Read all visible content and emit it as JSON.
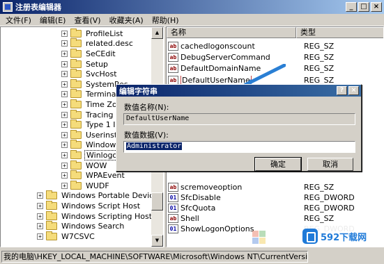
{
  "window": {
    "title": "注册表编辑器"
  },
  "menu": [
    "文件(F)",
    "编辑(E)",
    "查看(V)",
    "收藏夹(A)",
    "帮助(H)"
  ],
  "tree": [
    {
      "label": "ProfileList",
      "depth": 2
    },
    {
      "label": "related.desc",
      "depth": 2
    },
    {
      "label": "SeCEdit",
      "depth": 2
    },
    {
      "label": "Setup",
      "depth": 2
    },
    {
      "label": "SvcHost",
      "depth": 2
    },
    {
      "label": "SystemRes",
      "depth": 2
    },
    {
      "label": "Terminal Se",
      "depth": 2
    },
    {
      "label": "Time Zones",
      "depth": 2
    },
    {
      "label": "Tracing",
      "depth": 2
    },
    {
      "label": "Type 1 Ins",
      "depth": 2
    },
    {
      "label": "Userinstalla",
      "depth": 2
    },
    {
      "label": "Windows",
      "depth": 2
    },
    {
      "label": "Winlogon",
      "depth": 2,
      "selected": true
    },
    {
      "label": "WOW",
      "depth": 2
    },
    {
      "label": "WPAEvent",
      "depth": 2
    },
    {
      "label": "WUDF",
      "depth": 2
    },
    {
      "label": "Windows Portable Devices",
      "depth": 1
    },
    {
      "label": "Windows Script Host",
      "depth": 1
    },
    {
      "label": "Windows Scripting Host",
      "depth": 1
    },
    {
      "label": "Windows Search",
      "depth": 1
    },
    {
      "label": "W7CSVC",
      "depth": 1
    }
  ],
  "list": {
    "headers": {
      "name": "名称",
      "type": "类型"
    },
    "rows": [
      {
        "name": "cachedlogonscount",
        "type": "REG_SZ",
        "icon": "ab"
      },
      {
        "name": "DebugServerCommand",
        "type": "REG_SZ",
        "icon": "ab"
      },
      {
        "name": "DefaultDomainName",
        "type": "REG_SZ",
        "icon": "ab"
      },
      {
        "name": "DefaultUserName",
        "type": "REG_SZ",
        "icon": "ab",
        "highlight": true
      },
      {
        "name": "scremoveoption",
        "type": "REG_SZ",
        "icon": "ab"
      },
      {
        "name": "SfcDisable",
        "type": "REG_DWORD",
        "icon": "bin"
      },
      {
        "name": "SfcQuota",
        "type": "REG_DWORD",
        "icon": "bin"
      },
      {
        "name": "Shell",
        "type": "REG_SZ",
        "icon": "ab"
      },
      {
        "name": "ShowLogonOptions",
        "type": "REG_DWORD",
        "icon": "bin"
      }
    ]
  },
  "statusbar": {
    "text": "我的电脑\\HKEY_LOCAL_MACHINE\\SOFTWARE\\Microsoft\\Windows NT\\CurrentVersion\\Winlogon"
  },
  "dialog": {
    "title": "编辑字符串",
    "help_glyph": "?",
    "close_glyph": "×",
    "name_label": "数值名称(N):",
    "name_value": "DefaultUserName",
    "data_label": "数值数据(V):",
    "data_value": "Administrator",
    "ok_label": "确定",
    "cancel_label": "取消"
  },
  "watermark": {
    "text": "592下载网",
    "url_hint": "5928.COM"
  },
  "colors": {
    "titlebar": "#0a246a",
    "arrow": "#2a7fd4",
    "selection": "#0a246a"
  }
}
